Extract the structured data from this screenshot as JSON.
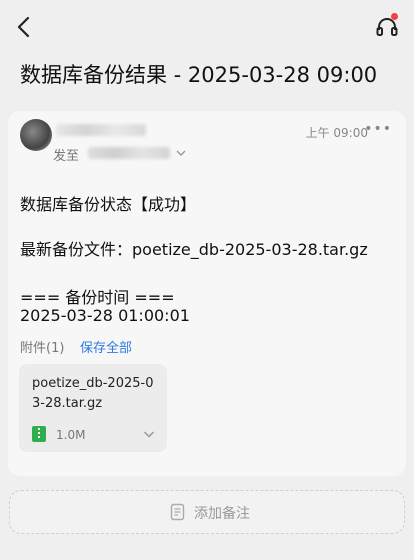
{
  "email": {
    "subject": "数据库备份结果 - 2025-03-28 09:00",
    "header": {
      "to_label": "发至",
      "time": "上午 09:00",
      "more": "•••"
    },
    "body": {
      "status_line": "数据库备份状态【成功】",
      "latest_file_line": "最新备份文件：poetize_db-2025-03-28.tar.gz",
      "time_header": "=== 备份时间 ===",
      "time_value": "2025-03-28 01:00:01"
    },
    "attachments": {
      "label": "附件(1)",
      "save_all": "保存全部",
      "files": [
        {
          "name": "poetize_db-2025-03-28.tar.gz",
          "size": "1.0M",
          "icon": "zip-file-icon"
        }
      ]
    },
    "note": {
      "placeholder": "添加备注"
    }
  },
  "colors": {
    "link": "#2c7be5",
    "notification_dot": "#f04141",
    "zip_icon": "#2faf4b"
  }
}
